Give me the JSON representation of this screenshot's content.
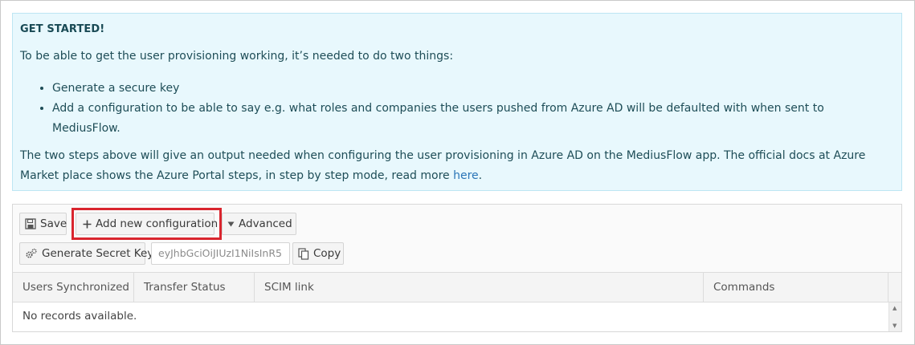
{
  "info": {
    "title": "GET STARTED!",
    "intro": "To be able to get the user provisioning working, it’s needed to do two things:",
    "bullets": [
      "Generate a secure key",
      "Add a configuration to be able to say e.g. what roles and companies the users pushed from Azure AD will be defaulted with when sent to MediusFlow."
    ],
    "outro_text": "The two steps above will give an output needed when configuring the user provisioning in Azure AD on the MediusFlow app. The official docs at Azure Market place shows the Azure Portal steps, in step by step mode, read more ",
    "link_label": "here",
    "outro_end": "."
  },
  "toolbar": {
    "save_label": "Save",
    "add_label": "Add new configuration",
    "advanced_label": "Advanced",
    "generate_label": "Generate Secret Key",
    "secret_key_value": "eyJhbGciOiJIUzI1NiIsInR5",
    "copy_label": "Copy"
  },
  "table": {
    "columns": [
      "Users Synchronized",
      "Transfer Status",
      "SCIM link",
      "Commands"
    ],
    "empty_message": "No records available."
  },
  "colors": {
    "info_bg": "#e8f8fd",
    "highlight": "#d9252e",
    "link": "#2a75b7"
  }
}
